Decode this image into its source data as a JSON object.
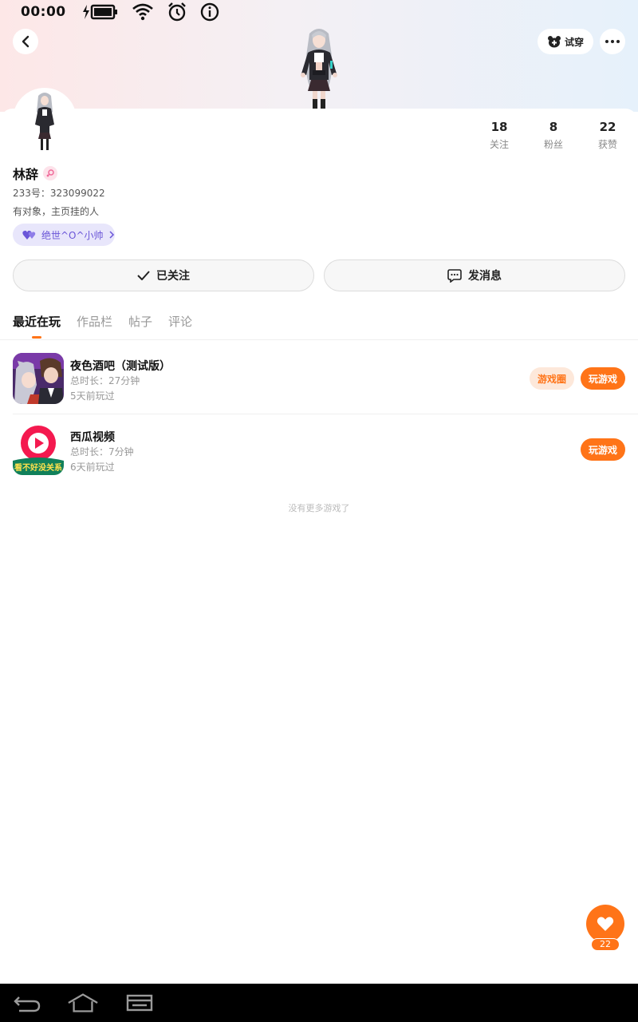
{
  "status_bar": {
    "time": "00:00"
  },
  "header": {
    "try_on_label": "试穿"
  },
  "profile": {
    "name": "林辞",
    "uid": "233号：323099022",
    "bio": "有对象，主页挂的人",
    "couple_tag": "绝世^O^小帅",
    "stats": [
      {
        "value": "18",
        "label": "关注"
      },
      {
        "value": "8",
        "label": "粉丝"
      },
      {
        "value": "22",
        "label": "获赞"
      }
    ]
  },
  "actions": {
    "followed_label": "已关注",
    "message_label": "发消息"
  },
  "tabs": [
    "最近在玩",
    "作品栏",
    "帖子",
    "评论"
  ],
  "games": [
    {
      "name": "夜色酒吧（测试版）",
      "duration": "总时长：27分钟",
      "last_played": "5天前玩过",
      "circle_label": "游戏圈",
      "play_label": "玩游戏"
    },
    {
      "name": "西瓜视频",
      "duration": "总时长：7分钟",
      "last_played": "6天前玩过",
      "play_label": "玩游戏",
      "icon_caption": "看不好没关系"
    }
  ],
  "no_more_text": "没有更多游戏了",
  "like": {
    "count": "22"
  },
  "colors": {
    "accent": "#ff7418",
    "couple": "#6a55d8"
  },
  "icons": [
    "back-arrow-icon",
    "bear-icon",
    "more-dots-icon",
    "heart-icon",
    "check-icon",
    "message-icon",
    "female-icon"
  ]
}
